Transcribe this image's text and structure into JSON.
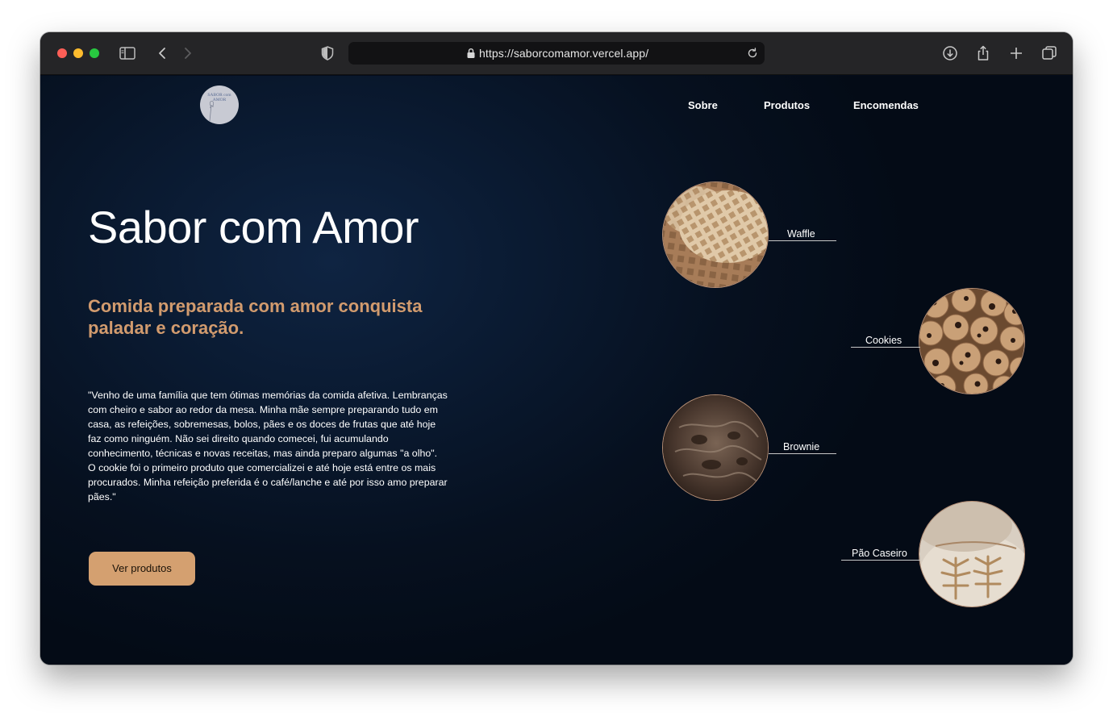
{
  "browser": {
    "url": "https://saborcomamor.vercel.app/"
  },
  "logo": {
    "line1": "SABOR com",
    "line2": "AMOR"
  },
  "nav": {
    "items": [
      {
        "label": "Sobre"
      },
      {
        "label": "Produtos"
      },
      {
        "label": "Encomendas"
      }
    ]
  },
  "hero": {
    "title": "Sabor com Amor",
    "subtitle": "Comida preparada com amor conquista paladar e coração.",
    "body": "\"Venho de uma família que tem ótimas memórias da comida afetiva. Lembranças com cheiro e sabor ao redor da mesa. Minha mãe sempre preparando tudo em casa, as refeições, sobremesas, bolos, pães e os doces de frutas que até hoje faz como ninguém. Não sei direito quando comecei, fui acumulando conhecimento, técnicas e novas receitas, mas ainda preparo algumas \"a olho\". O cookie foi o primeiro produto que comercializei e até hoje está entre os mais procurados. Minha refeição preferida é o café/lanche e até por isso amo preparar pães.\"",
    "cta_label": "Ver produtos"
  },
  "products": [
    {
      "label": "Waffle"
    },
    {
      "label": "Cookies"
    },
    {
      "label": "Brownie"
    },
    {
      "label": "Pão Caseiro"
    }
  ],
  "colors": {
    "accent": "#d29b6e",
    "button": "#d4a070",
    "background": "#040c1a"
  }
}
